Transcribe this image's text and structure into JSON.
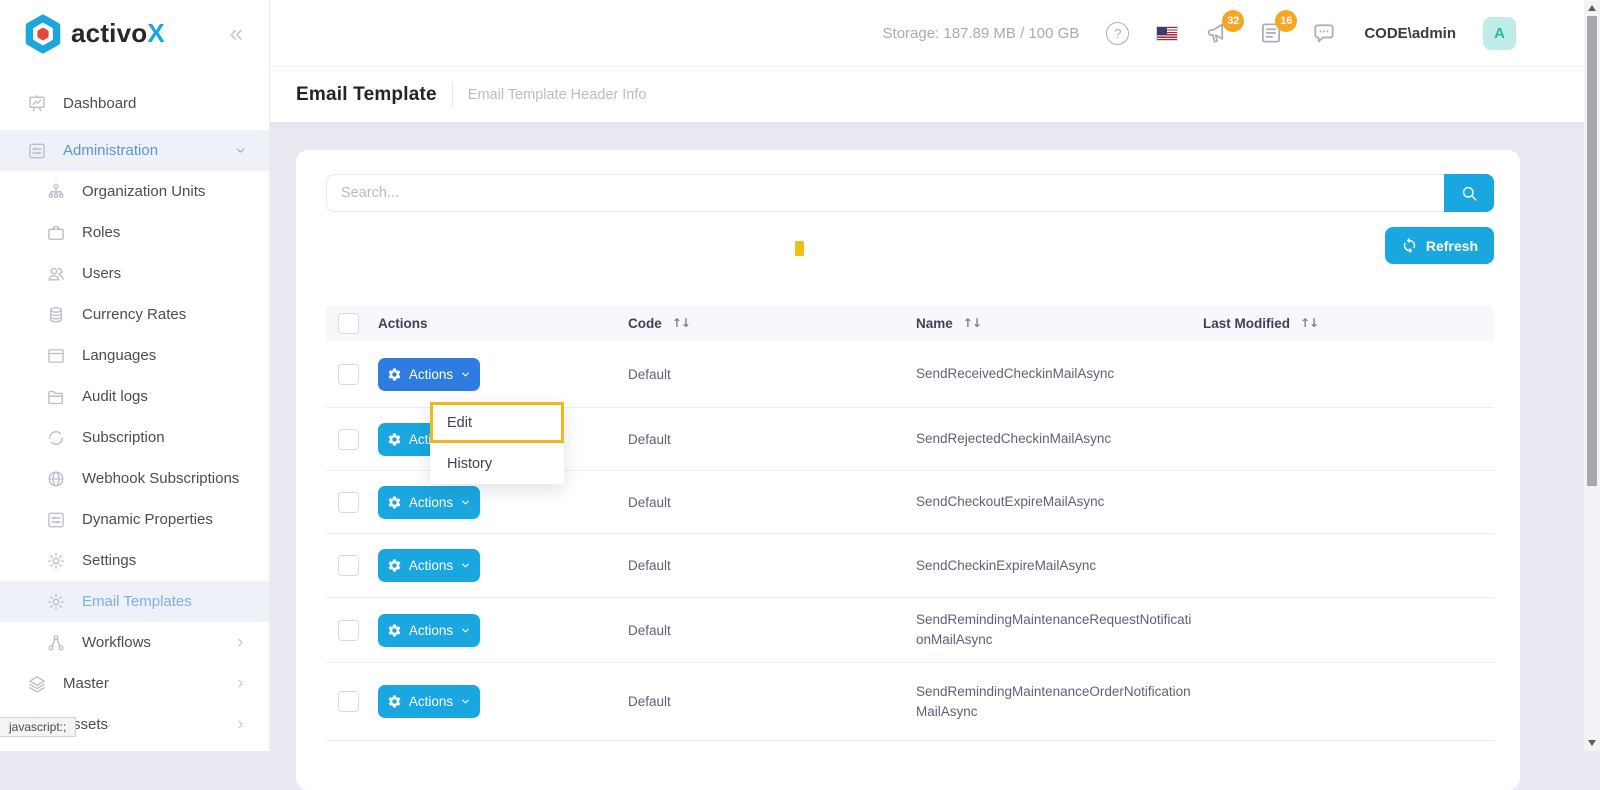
{
  "brand": {
    "name": "activo",
    "accent": "X"
  },
  "topbar": {
    "storage_label": "Storage: 187.89 MB / 100 GB",
    "help_glyph": "?",
    "badges": {
      "announcements": "32",
      "notifications": "16"
    },
    "username": "CODE\\admin",
    "avatar_initial": "A"
  },
  "page_header": {
    "title": "Email Template",
    "subtitle": "Email Template Header Info"
  },
  "sidebar": {
    "collapse_glyph": "«",
    "items": [
      {
        "label": "Dashboard"
      },
      {
        "label": "Administration"
      },
      {
        "label": "Organization Units"
      },
      {
        "label": "Roles"
      },
      {
        "label": "Users"
      },
      {
        "label": "Currency Rates"
      },
      {
        "label": "Languages"
      },
      {
        "label": "Audit logs"
      },
      {
        "label": "Subscription"
      },
      {
        "label": "Webhook Subscriptions"
      },
      {
        "label": "Dynamic Properties"
      },
      {
        "label": "Settings"
      },
      {
        "label": "Email Templates"
      },
      {
        "label": "Workflows"
      },
      {
        "label": "Master"
      },
      {
        "label": "Assets"
      }
    ]
  },
  "toolbar": {
    "search_placeholder": "Search...",
    "refresh_label": "Refresh",
    "actions_label": "Actions"
  },
  "table": {
    "sort_glyph": "↑↓",
    "headers": {
      "actions": "Actions",
      "code": "Code",
      "name": "Name",
      "last_modified": "Last Modified"
    },
    "rows": [
      {
        "code": "Default",
        "name": "SendReceivedCheckinMailAsync",
        "last_modified": ""
      },
      {
        "code": "Default",
        "name": "SendRejectedCheckinMailAsync",
        "last_modified": ""
      },
      {
        "code": "Default",
        "name": "SendCheckoutExpireMailAsync",
        "last_modified": ""
      },
      {
        "code": "Default",
        "name": "SendCheckinExpireMailAsync",
        "last_modified": ""
      },
      {
        "code": "Default",
        "name": "SendRemindingMaintenanceRequestNotificationMailAsync",
        "last_modified": ""
      },
      {
        "code": "Default",
        "name": "SendRemindingMaintenanceOrderNotificationMailAsync",
        "last_modified": ""
      }
    ]
  },
  "dropdown": {
    "items": [
      {
        "label": "Edit"
      },
      {
        "label": "History"
      }
    ]
  },
  "status_bar": {
    "tooltip": "javascript:;"
  },
  "colors": {
    "primary": "#1AA7E0",
    "primary_active": "#2E7CE0",
    "badge_orange": "#F5A623",
    "highlight_yellow": "#F0B71C",
    "avatar_bg": "#BDEDE6",
    "avatar_text": "#2BB5A6",
    "page_bg": "#E9E9F1"
  }
}
